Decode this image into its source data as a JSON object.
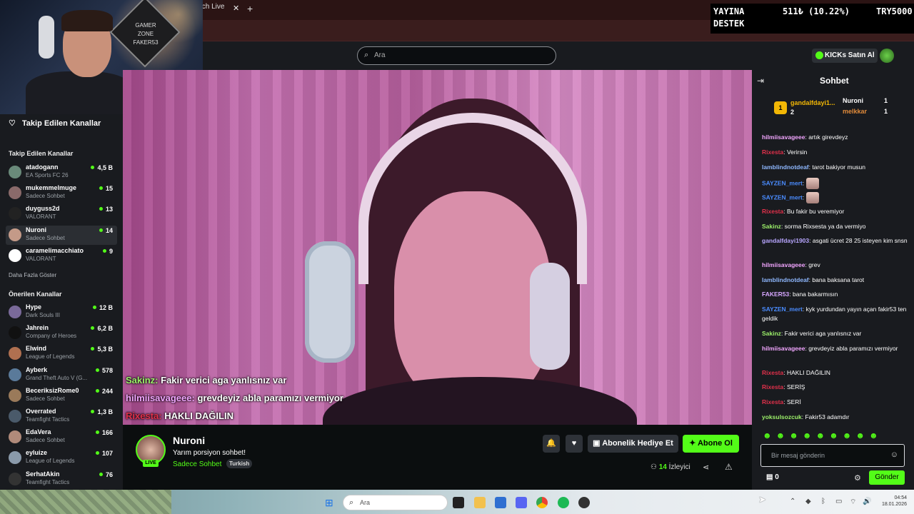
{
  "browser": {
    "tab_title": "tch Live",
    "tab_close": "✕",
    "new_tab": "+"
  },
  "search": {
    "placeholder": "Ara",
    "icon": "search-icon"
  },
  "header": {
    "kicks_button": "KICKs Satın Al"
  },
  "webcam_sign": {
    "line1": "GAMER",
    "line2": "ZONE",
    "line3": "FAKER53"
  },
  "stats_overlay": {
    "line1": "YAYINA",
    "line2": "DESTEK",
    "amount": "511₺ (10.22%)",
    "code": "TRY5000"
  },
  "sidebar": {
    "followed_header": "Takip Edilen Kanallar",
    "followed_title": "Takip Edilen Kanallar",
    "followed": [
      {
        "name": "atadogann",
        "game": "EA Sports FC 26",
        "viewers": "4,5 B",
        "avatar_color": "#6a8a7a"
      },
      {
        "name": "mukemmelmuge",
        "game": "Sadece Sohbet",
        "viewers": "15",
        "avatar_color": "#8a6a6a"
      },
      {
        "name": "duyguss2d",
        "game": "VALORANT",
        "viewers": "13",
        "avatar_color": "#222222"
      },
      {
        "name": "Nuroni",
        "game": "Sadece Sohbet",
        "viewers": "14",
        "avatar_color": "#c49a88"
      },
      {
        "name": "caramelimacchiato",
        "game": "VALORANT",
        "viewers": "9",
        "avatar_color": "#ffffff"
      }
    ],
    "show_more": "Daha Fazla Göster",
    "recommended_title": "Önerilen Kanallar",
    "recommended": [
      {
        "name": "Hype",
        "game": "Dark Souls III",
        "viewers": "12 B",
        "avatar_color": "#7a6a9a"
      },
      {
        "name": "Jahrein",
        "game": "Company of Heroes",
        "viewers": "6,2 B",
        "avatar_color": "#111111"
      },
      {
        "name": "Elwind",
        "game": "League of Legends",
        "viewers": "5,3 B",
        "avatar_color": "#b07050"
      },
      {
        "name": "Ayberk",
        "game": "Grand Theft Auto V (G...",
        "viewers": "578",
        "avatar_color": "#5a7a9a"
      },
      {
        "name": "BeceriksizRome0",
        "game": "Sadece Sohbet",
        "viewers": "244",
        "avatar_color": "#9a7a5a"
      },
      {
        "name": "Overrated",
        "game": "Teamfight Tactics",
        "viewers": "1,3 B",
        "avatar_color": "#4a5a6a"
      },
      {
        "name": "EdaVera",
        "game": "Sadece Sohbet",
        "viewers": "166",
        "avatar_color": "#b08a7a"
      },
      {
        "name": "eyluize",
        "game": "League of Legends",
        "viewers": "107",
        "avatar_color": "#8a9aaa"
      },
      {
        "name": "SerhatAkin",
        "game": "Teamfight Tactics",
        "viewers": "76",
        "avatar_color": "#333333"
      }
    ]
  },
  "video_overlay": [
    {
      "user": "Sakinz:",
      "text": " Fakir verici aga yanlısnız var",
      "color": "#9cf06a"
    },
    {
      "user": "hilmiisavageee:",
      "text": " grevdeyiz abla paramızı vermiyor",
      "color": "#f2a6ff"
    },
    {
      "user": "Rixesta:",
      "text": " HAKLI DAĞILIN",
      "color": "#e0304a"
    }
  ],
  "stream": {
    "streamer": "Nuroni",
    "live": "LIVE",
    "title": "Yarım porsiyon sohbet!",
    "category": "Sadece Sohbet",
    "tag": "Turkish",
    "gift_button": "Abonelik Hediye Et",
    "subscribe_button": "Abone Ol",
    "viewers_count": "14",
    "viewers_label": "İzleyici"
  },
  "chat": {
    "title": "Sohbet",
    "leaderboard": {
      "first_name": "gandalfdayi1...",
      "first_count": "2",
      "second_name": "Nuroni",
      "second_count": "1",
      "third_name": "melkkar",
      "third_count": "1"
    },
    "messages": [
      {
        "user": "hilmiisavageee",
        "text": ": artık girevdeyz",
        "color": "#f2a6ff"
      },
      {
        "user": "Rixesta",
        "text": ": Verirsin",
        "color": "#e0304a"
      },
      {
        "user": "lamblindnotdeaf",
        "text": ": tarot bakiyor musun",
        "color": "#8fb8ff"
      },
      {
        "user": "SAYZEN_mert",
        "text": ":",
        "color": "#4a8cff",
        "emote": true
      },
      {
        "user": "SAYZEN_mert",
        "text": ":",
        "color": "#4a8cff",
        "emote": true
      },
      {
        "user": "Rixesta",
        "text": ": Bu fakir bu veremiyor",
        "color": "#e0304a"
      },
      {
        "user": "Sakinz",
        "text": ": sorma Rixsesta ya da vermiyo",
        "color": "#9cf06a"
      },
      {
        "user": "gandalfdayi1903",
        "text": ": asgati ücret 28 25 isteyen kim snsn",
        "color": "#b8a6ff"
      },
      {
        "user": "hilmiisavageee",
        "text": ": grev",
        "color": "#f2a6ff"
      },
      {
        "user": "lamblindnotdeaf",
        "text": ": bana baksana tarot",
        "color": "#8fb8ff"
      },
      {
        "user": "FAKER53",
        "text": ": bana bakarmısın",
        "color": "#d6a6ff"
      },
      {
        "user": "SAYZEN_mert",
        "text": ": kyk yurdundan yayın açan fakir53 ten geldik",
        "color": "#4a8cff"
      },
      {
        "user": "Sakinz",
        "text": ": Fakir verici aga yanlısnız var",
        "color": "#9cf06a"
      },
      {
        "user": "hilmiisavageee",
        "text": ": grevdeyiz abla paramızı vermiyor",
        "color": "#f2a6ff"
      },
      {
        "user": "Rixesta",
        "text": ": HAKLI DAĞILIN",
        "color": "#e0304a"
      },
      {
        "user": "Rixesta",
        "text": ": SERİŞ",
        "color": "#e0304a"
      },
      {
        "user": "Rixesta",
        "text": ": SERİ",
        "color": "#e0304a"
      },
      {
        "user": "yoksulsozcuk",
        "text": ": Fakir53 adamdır",
        "color": "#9cf06a"
      }
    ],
    "input_placeholder": "Bir mesaj gönderin",
    "points": "0",
    "send_button": "Gönder"
  },
  "taskbar": {
    "search_placeholder": "Ara",
    "time": "04:54",
    "date": "18.01.2026"
  },
  "colors": {
    "accent": "#53fc18",
    "panel": "#191b1f",
    "background": "#0b0e0f"
  }
}
